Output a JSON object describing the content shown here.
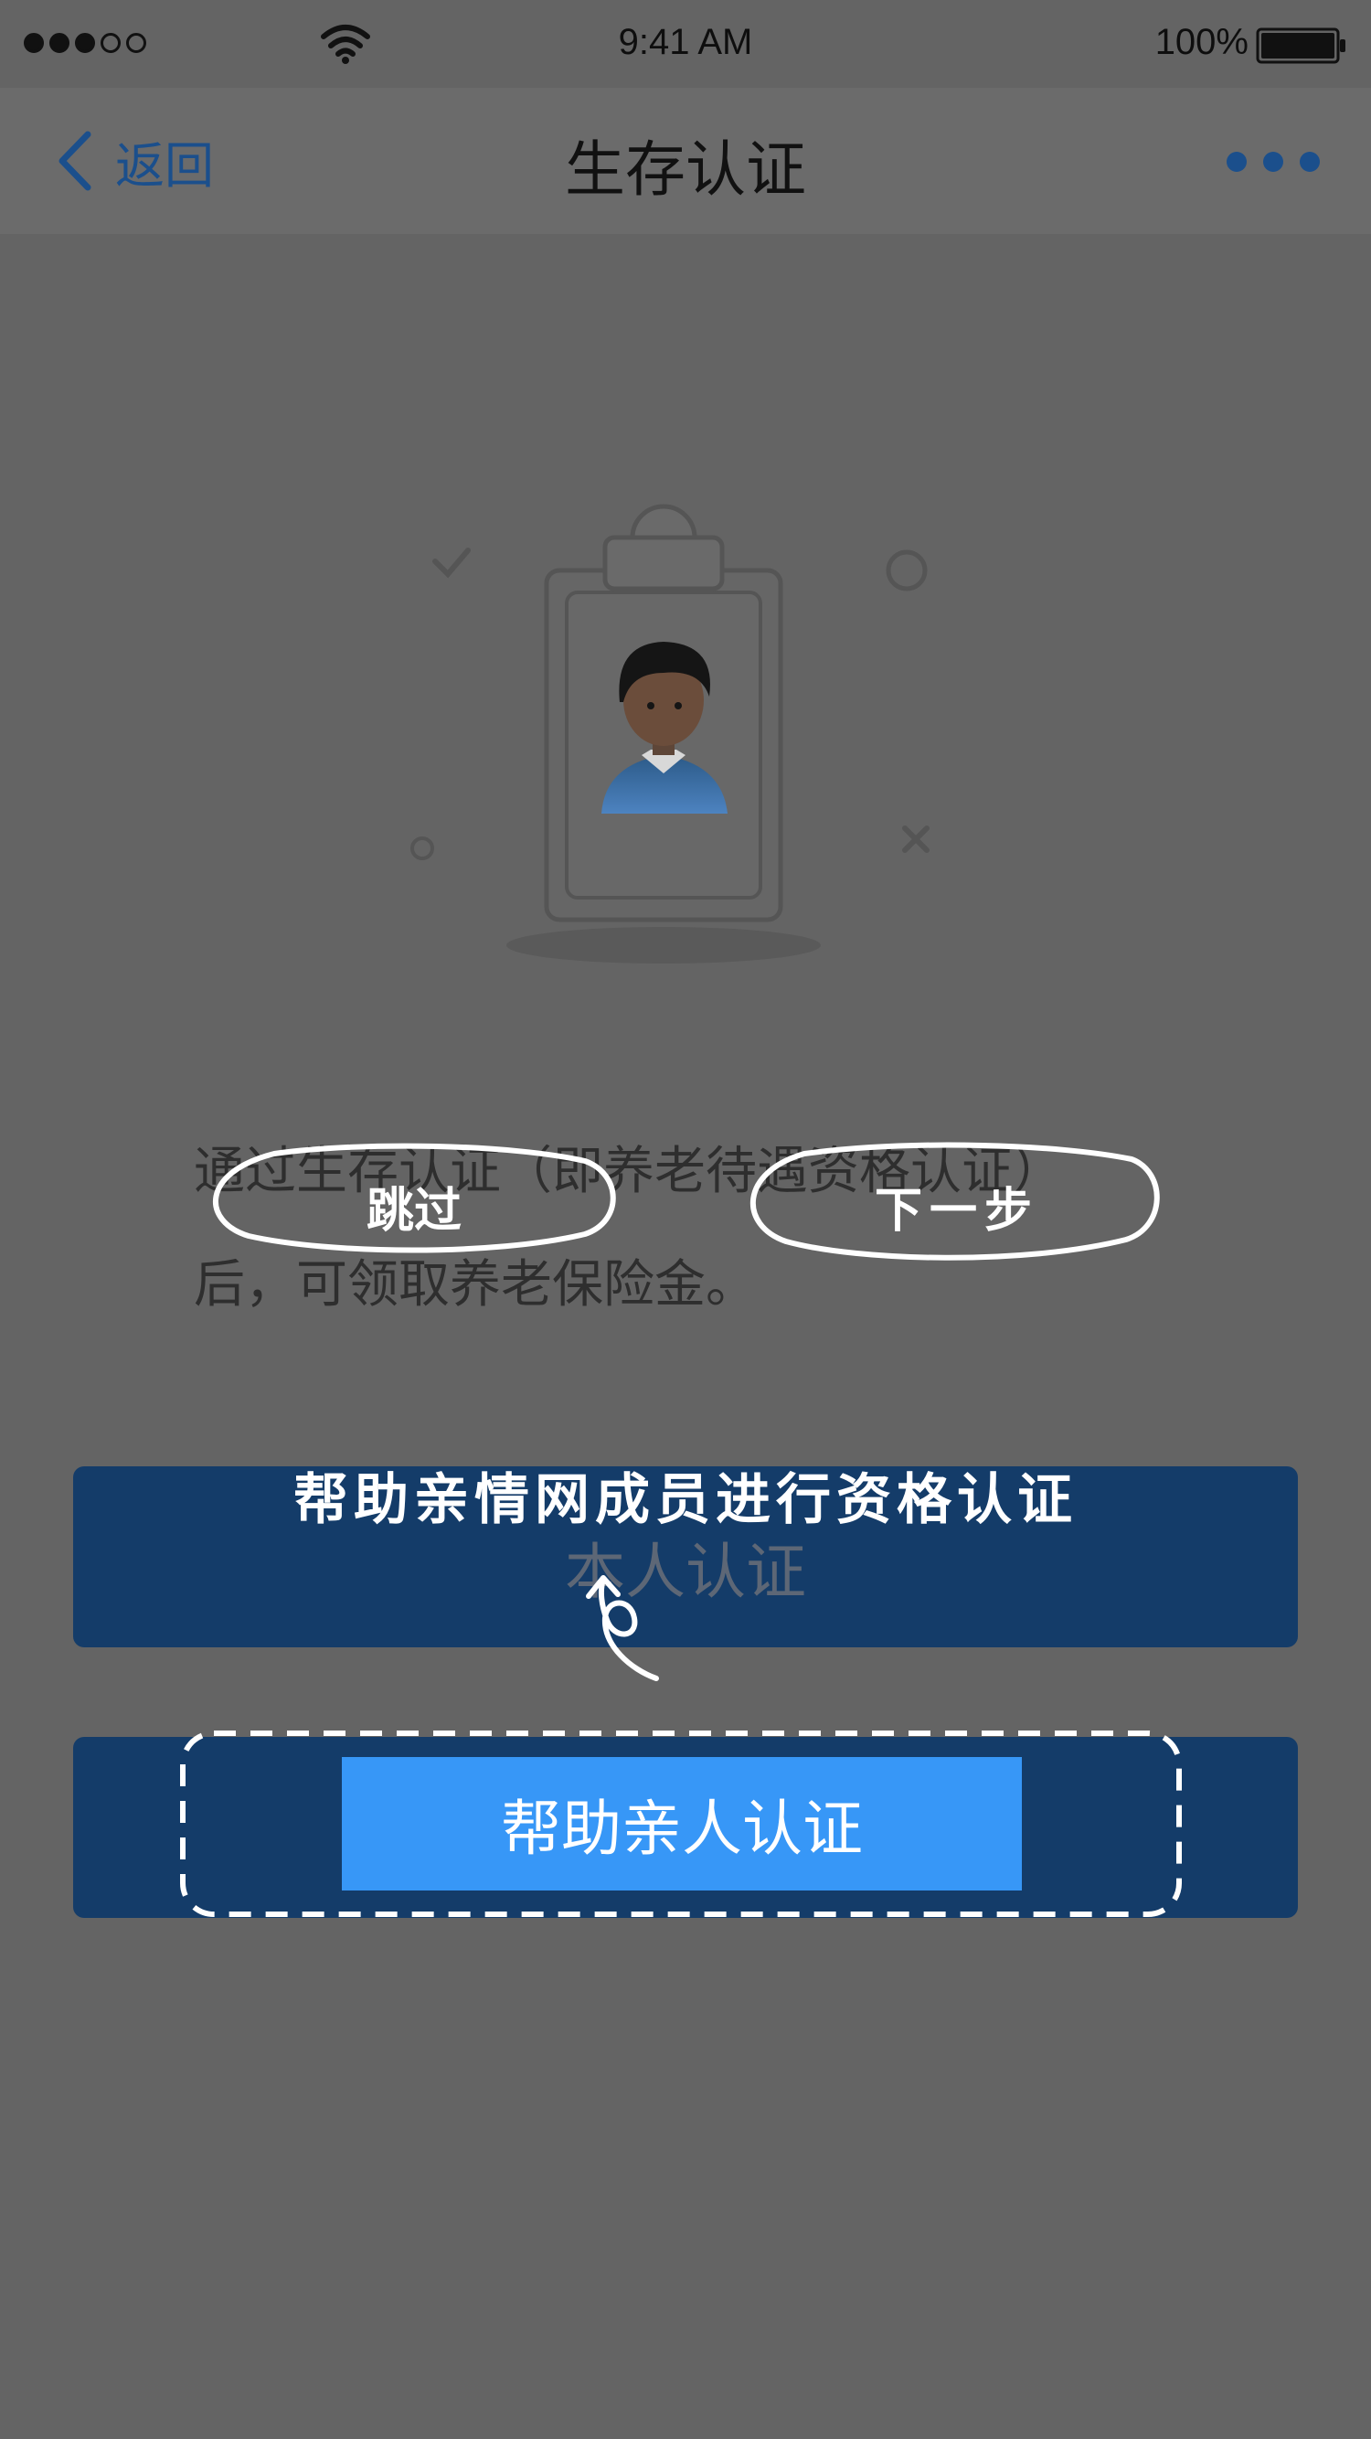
{
  "status_bar": {
    "time": "9:41 AM",
    "battery": "100%",
    "signal_icon": "signal-dots-icon",
    "wifi_icon": "wifi-icon",
    "battery_icon": "battery-icon"
  },
  "nav": {
    "back_label": "返回",
    "title": "生存认证",
    "more_icon": "more-dots-icon",
    "accent_color": "#1b4f8c"
  },
  "illustration": {
    "icon": "id-card-clipboard-icon"
  },
  "description": {
    "line1": "通过生存认证（即养老待遇资格认证）",
    "line2": "后，可领取养老保险金。"
  },
  "buttons": {
    "self_auth": "本人认证",
    "help_relative": "帮助亲人认证",
    "button_color": "#143c69",
    "highlight_color": "#3797f7"
  },
  "guide": {
    "skip": "跳过",
    "next": "下一步",
    "tip": "帮助亲情网成员进行资格认证"
  }
}
